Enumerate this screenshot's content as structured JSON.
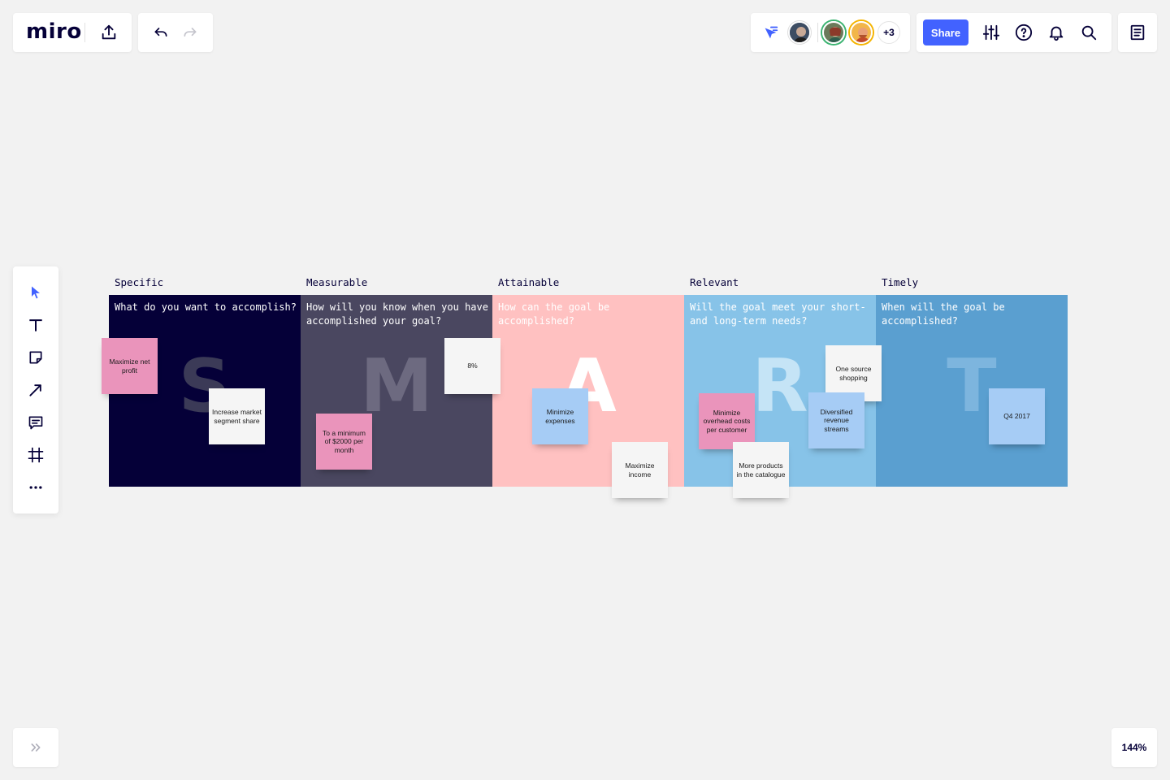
{
  "app": {
    "logo": "miro"
  },
  "collaborators": {
    "extra_count": "+3"
  },
  "topbar": {
    "share_label": "Share"
  },
  "zoom": {
    "level": "144%"
  },
  "board": {
    "columns": [
      {
        "title": "Specific",
        "question": "What do you want to accomplish?",
        "letter": "S",
        "bg": "#050038",
        "question_color": "#ffffff",
        "letter_color": "#3b3a57"
      },
      {
        "title": "Measurable",
        "question": "How will you know when you have accomplished your goal?",
        "letter": "M",
        "bg": "#4a4760",
        "question_color": "#ffffff",
        "letter_color": "#6d6a80"
      },
      {
        "title": "Attainable",
        "question": "How can the goal be accomplished?",
        "letter": "A",
        "bg": "#ffc1c1",
        "question_color": "#ffffff",
        "letter_color": "#ffffff"
      },
      {
        "title": "Relevant",
        "question": "Will the goal meet your short- and long-term needs?",
        "letter": "R",
        "bg": "#87c3e8",
        "question_color": "#ffffff",
        "letter_color": "#c5e4f6"
      },
      {
        "title": "Timely",
        "question": "When will the goal be accomplished?",
        "letter": "T",
        "bg": "#5a9fd0",
        "question_color": "#ffffff",
        "letter_color": "#7db5de"
      }
    ],
    "stickies": [
      {
        "text": "Maximize net profit",
        "color": "#ea94bb"
      },
      {
        "text": "Increase market segment share",
        "color": "#f5f5f5"
      },
      {
        "text": "8%",
        "color": "#f5f5f5"
      },
      {
        "text": "To a minimum of $2000 per month",
        "color": "#ea94bb"
      },
      {
        "text": "Minimize expenses",
        "color": "#a6ccf5"
      },
      {
        "text": "Maximize income",
        "color": "#f5f5f5"
      },
      {
        "text": "One source shopping",
        "color": "#f5f5f5"
      },
      {
        "text": "Minimize overhead costs per customer",
        "color": "#ea94bb"
      },
      {
        "text": "Diversified revenue streams",
        "color": "#a6ccf5"
      },
      {
        "text": "More products in the catalogue",
        "color": "#f5f5f5"
      },
      {
        "text": "Q4 2017",
        "color": "#a6ccf5"
      }
    ]
  },
  "colors": {
    "accent": "#4262ff",
    "ink": "#050038",
    "canvas": "#f2f2f2"
  }
}
